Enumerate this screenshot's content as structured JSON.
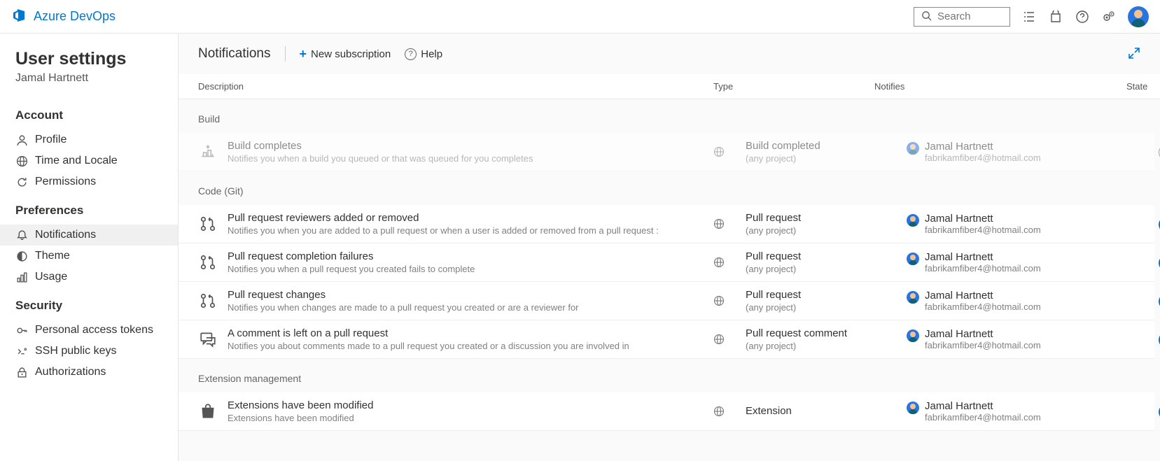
{
  "brand": "Azure DevOps",
  "search": {
    "placeholder": "Search"
  },
  "page": {
    "title": "User settings",
    "subtitle": "Jamal Hartnett"
  },
  "sidebar": {
    "groups": [
      {
        "label": "Account",
        "items": [
          {
            "icon": "person",
            "label": "Profile"
          },
          {
            "icon": "globe",
            "label": "Time and Locale"
          },
          {
            "icon": "refresh",
            "label": "Permissions"
          }
        ]
      },
      {
        "label": "Preferences",
        "items": [
          {
            "icon": "bell",
            "label": "Notifications",
            "active": true
          },
          {
            "icon": "theme",
            "label": "Theme"
          },
          {
            "icon": "chart",
            "label": "Usage"
          }
        ]
      },
      {
        "label": "Security",
        "items": [
          {
            "icon": "key",
            "label": "Personal access tokens"
          },
          {
            "icon": "ssh",
            "label": "SSH public keys"
          },
          {
            "icon": "lock",
            "label": "Authorizations"
          }
        ]
      }
    ]
  },
  "content": {
    "title": "Notifications",
    "new_subscription": "New subscription",
    "help": "Help",
    "columns": {
      "description": "Description",
      "type": "Type",
      "notifies": "Notifies",
      "state": "State"
    },
    "groups": [
      {
        "label": "Build",
        "rows": [
          {
            "icon": "build",
            "title": "Build completes",
            "sub": "Notifies you when a build you queued or that was queued for you completes",
            "type": "Build completed",
            "type_sub": "(any project)",
            "notif_name": "Jamal Hartnett",
            "notif_email": "fabrikamfiber4@hotmail.com",
            "state": false,
            "show_globe": true
          }
        ]
      },
      {
        "label": "Code (Git)",
        "rows": [
          {
            "icon": "pr",
            "title": "Pull request reviewers added or removed",
            "sub": "Notifies you when you are added to a pull request or when a user is added or removed from a pull request :",
            "type": "Pull request",
            "type_sub": "(any project)",
            "notif_name": "Jamal Hartnett",
            "notif_email": "fabrikamfiber4@hotmail.com",
            "state": true,
            "show_globe": true
          },
          {
            "icon": "pr",
            "title": "Pull request completion failures",
            "sub": "Notifies you when a pull request you created fails to complete",
            "type": "Pull request",
            "type_sub": "(any project)",
            "notif_name": "Jamal Hartnett",
            "notif_email": "fabrikamfiber4@hotmail.com",
            "state": true,
            "show_globe": true
          },
          {
            "icon": "pr",
            "title": "Pull request changes",
            "sub": "Notifies you when changes are made to a pull request you created or are a reviewer for",
            "type": "Pull request",
            "type_sub": "(any project)",
            "notif_name": "Jamal Hartnett",
            "notif_email": "fabrikamfiber4@hotmail.com",
            "state": true,
            "show_globe": true
          },
          {
            "icon": "comment",
            "title": "A comment is left on a pull request",
            "sub": "Notifies you about comments made to a pull request you created or a discussion you are involved in",
            "type": "Pull request comment",
            "type_sub": "(any project)",
            "notif_name": "Jamal Hartnett",
            "notif_email": "fabrikamfiber4@hotmail.com",
            "state": true,
            "show_globe": true
          }
        ]
      },
      {
        "label": "Extension management",
        "rows": [
          {
            "icon": "bag",
            "title": "Extensions have been modified",
            "sub": "Extensions have been modified",
            "type": "Extension",
            "type_sub": "",
            "notif_name": "Jamal Hartnett",
            "notif_email": "fabrikamfiber4@hotmail.com",
            "state": true,
            "show_globe": true
          }
        ]
      }
    ]
  }
}
